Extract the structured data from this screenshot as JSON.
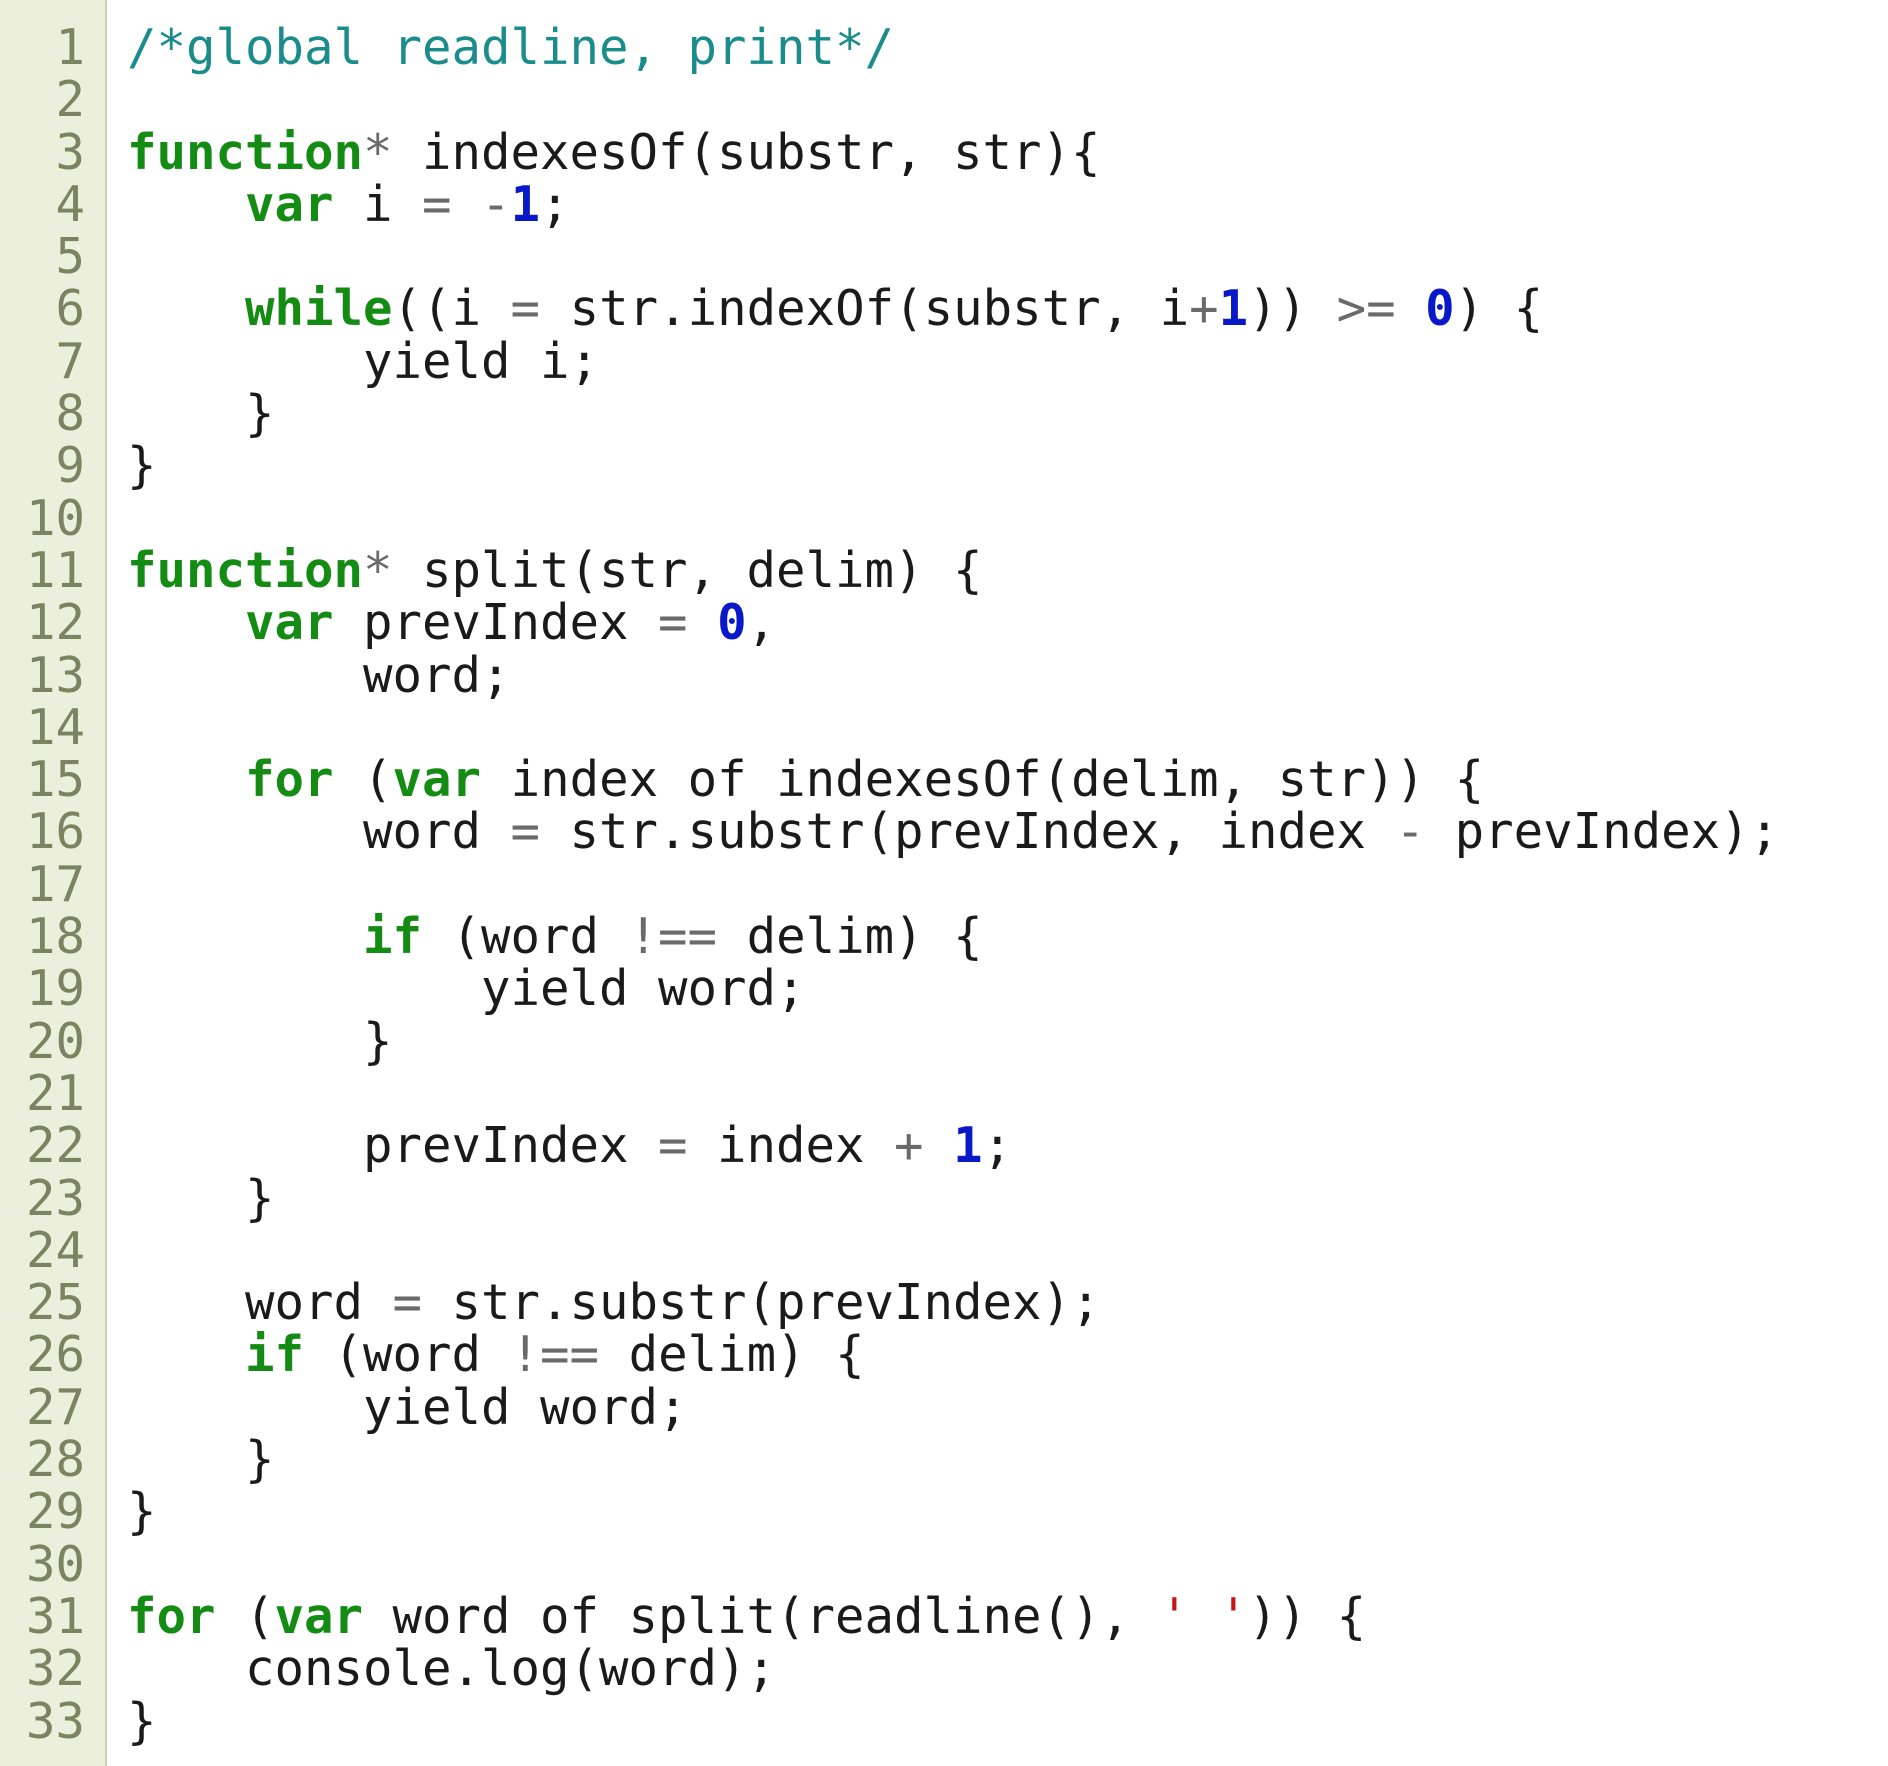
{
  "editor": {
    "lines": [
      [
        {
          "t": "com",
          "v": "/*global readline, print*/"
        }
      ],
      [],
      [
        {
          "t": "kw",
          "v": "function"
        },
        {
          "t": "op",
          "v": "*"
        },
        {
          "t": "plain",
          "v": " indexesOf(substr, str){"
        }
      ],
      [
        {
          "t": "plain",
          "v": "    "
        },
        {
          "t": "kw",
          "v": "var"
        },
        {
          "t": "plain",
          "v": " i "
        },
        {
          "t": "op",
          "v": "="
        },
        {
          "t": "plain",
          "v": " "
        },
        {
          "t": "op",
          "v": "-"
        },
        {
          "t": "num",
          "v": "1"
        },
        {
          "t": "plain",
          "v": ";"
        }
      ],
      [],
      [
        {
          "t": "plain",
          "v": "    "
        },
        {
          "t": "kw",
          "v": "while"
        },
        {
          "t": "plain",
          "v": "((i "
        },
        {
          "t": "op",
          "v": "="
        },
        {
          "t": "plain",
          "v": " str.indexOf(substr, i"
        },
        {
          "t": "op",
          "v": "+"
        },
        {
          "t": "num",
          "v": "1"
        },
        {
          "t": "plain",
          "v": ")) "
        },
        {
          "t": "op",
          "v": ">="
        },
        {
          "t": "plain",
          "v": " "
        },
        {
          "t": "num",
          "v": "0"
        },
        {
          "t": "plain",
          "v": ") {"
        }
      ],
      [
        {
          "t": "plain",
          "v": "        yield i;"
        }
      ],
      [
        {
          "t": "plain",
          "v": "    }"
        }
      ],
      [
        {
          "t": "plain",
          "v": "}"
        }
      ],
      [],
      [
        {
          "t": "kw",
          "v": "function"
        },
        {
          "t": "op",
          "v": "*"
        },
        {
          "t": "plain",
          "v": " split(str, delim) {"
        }
      ],
      [
        {
          "t": "plain",
          "v": "    "
        },
        {
          "t": "kw",
          "v": "var"
        },
        {
          "t": "plain",
          "v": " prevIndex "
        },
        {
          "t": "op",
          "v": "="
        },
        {
          "t": "plain",
          "v": " "
        },
        {
          "t": "num",
          "v": "0"
        },
        {
          "t": "plain",
          "v": ","
        }
      ],
      [
        {
          "t": "plain",
          "v": "        word;"
        }
      ],
      [],
      [
        {
          "t": "plain",
          "v": "    "
        },
        {
          "t": "kw",
          "v": "for"
        },
        {
          "t": "plain",
          "v": " ("
        },
        {
          "t": "kw",
          "v": "var"
        },
        {
          "t": "plain",
          "v": " index of indexesOf(delim, str)) {"
        }
      ],
      [
        {
          "t": "plain",
          "v": "        word "
        },
        {
          "t": "op",
          "v": "="
        },
        {
          "t": "plain",
          "v": " str.substr(prevIndex, index "
        },
        {
          "t": "op",
          "v": "-"
        },
        {
          "t": "plain",
          "v": " prevIndex);"
        }
      ],
      [],
      [
        {
          "t": "plain",
          "v": "        "
        },
        {
          "t": "kw",
          "v": "if"
        },
        {
          "t": "plain",
          "v": " (word "
        },
        {
          "t": "op",
          "v": "!=="
        },
        {
          "t": "plain",
          "v": " delim) {"
        }
      ],
      [
        {
          "t": "plain",
          "v": "            yield word;"
        }
      ],
      [
        {
          "t": "plain",
          "v": "        }"
        }
      ],
      [],
      [
        {
          "t": "plain",
          "v": "        prevIndex "
        },
        {
          "t": "op",
          "v": "="
        },
        {
          "t": "plain",
          "v": " index "
        },
        {
          "t": "op",
          "v": "+"
        },
        {
          "t": "plain",
          "v": " "
        },
        {
          "t": "num",
          "v": "1"
        },
        {
          "t": "plain",
          "v": ";"
        }
      ],
      [
        {
          "t": "plain",
          "v": "    }"
        }
      ],
      [],
      [
        {
          "t": "plain",
          "v": "    word "
        },
        {
          "t": "op",
          "v": "="
        },
        {
          "t": "plain",
          "v": " str.substr(prevIndex);"
        }
      ],
      [
        {
          "t": "plain",
          "v": "    "
        },
        {
          "t": "kw",
          "v": "if"
        },
        {
          "t": "plain",
          "v": " (word "
        },
        {
          "t": "op",
          "v": "!=="
        },
        {
          "t": "plain",
          "v": " delim) {"
        }
      ],
      [
        {
          "t": "plain",
          "v": "        yield word;"
        }
      ],
      [
        {
          "t": "plain",
          "v": "    }"
        }
      ],
      [
        {
          "t": "plain",
          "v": "}"
        }
      ],
      [],
      [
        {
          "t": "kw",
          "v": "for"
        },
        {
          "t": "plain",
          "v": " ("
        },
        {
          "t": "kw",
          "v": "var"
        },
        {
          "t": "plain",
          "v": " word of split(readline(), "
        },
        {
          "t": "str",
          "v": "' '"
        },
        {
          "t": "plain",
          "v": ")) {"
        }
      ],
      [
        {
          "t": "plain",
          "v": "    console.log(word);"
        }
      ],
      [
        {
          "t": "plain",
          "v": "}"
        }
      ]
    ]
  }
}
